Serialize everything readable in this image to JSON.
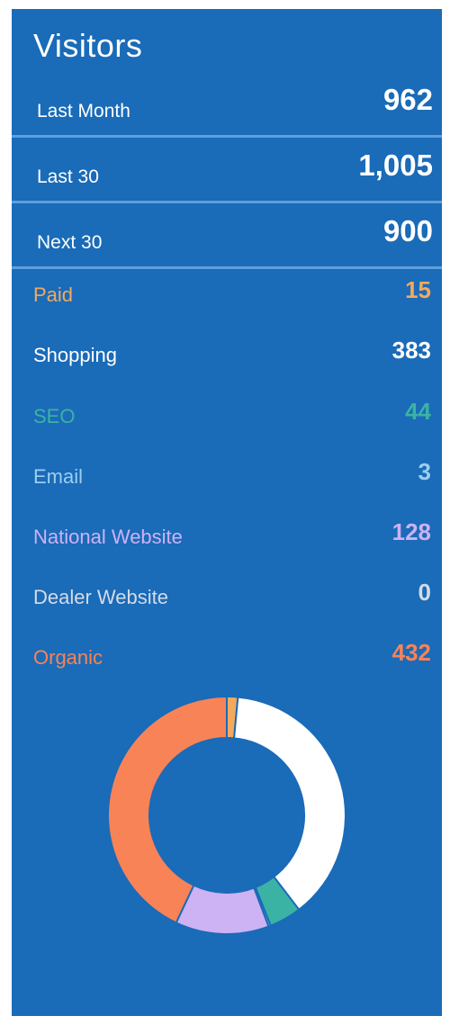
{
  "widget": {
    "title": "Visitors",
    "background_color": "#1a6bb8"
  },
  "summary": [
    {
      "label": "Last Month",
      "value": "962"
    },
    {
      "label": "Last 30",
      "value": "1,005"
    },
    {
      "label": "Next 30",
      "value": "900"
    }
  ],
  "sources": [
    {
      "label": "Paid",
      "value": "15",
      "color": "#f4a95c"
    },
    {
      "label": "Shopping",
      "value": "383",
      "color": "#ffffff"
    },
    {
      "label": "SEO",
      "value": "44",
      "color": "#3bb3a4"
    },
    {
      "label": "Email",
      "value": "3",
      "color": "#9ccef0"
    },
    {
      "label": "National Website",
      "value": "128",
      "color": "#cdb2f4"
    },
    {
      "label": "Dealer Website",
      "value": "0",
      "color": "#d5dbe6"
    },
    {
      "label": "Organic",
      "value": "432",
      "color": "#f88356"
    }
  ],
  "chart_data": {
    "type": "pie",
    "variant": "donut",
    "categories": [
      "Paid",
      "Shopping",
      "SEO",
      "Email",
      "National Website",
      "Dealer Website",
      "Organic"
    ],
    "values": [
      15,
      383,
      44,
      3,
      128,
      0,
      432
    ],
    "colors": [
      "#f4a95c",
      "#ffffff",
      "#3bb3a4",
      "#9ccef0",
      "#cdb2f4",
      "#d5dbe6",
      "#f88356"
    ],
    "title": "",
    "legend": "none"
  }
}
